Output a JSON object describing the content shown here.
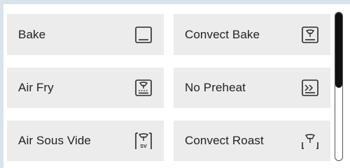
{
  "modes": [
    {
      "label": "Bake",
      "icon": "bake-icon"
    },
    {
      "label": "Convect Bake",
      "icon": "convect-bake-icon"
    },
    {
      "label": "Air Fry",
      "icon": "air-fry-icon"
    },
    {
      "label": "No Preheat",
      "icon": "no-preheat-icon"
    },
    {
      "label": "Air Sous Vide",
      "icon": "air-sous-vide-icon",
      "icon_text": "SV"
    },
    {
      "label": "Convect Roast",
      "icon": "convect-roast-icon"
    }
  ],
  "colors": {
    "background": "#d8e3ec",
    "tile": "#ececec",
    "text": "#222222",
    "icon_stroke": "#2a2a2a",
    "scroll_thumb": "#111111"
  },
  "scroll": {
    "position_fraction": 0.0,
    "visible_fraction": 0.5
  }
}
